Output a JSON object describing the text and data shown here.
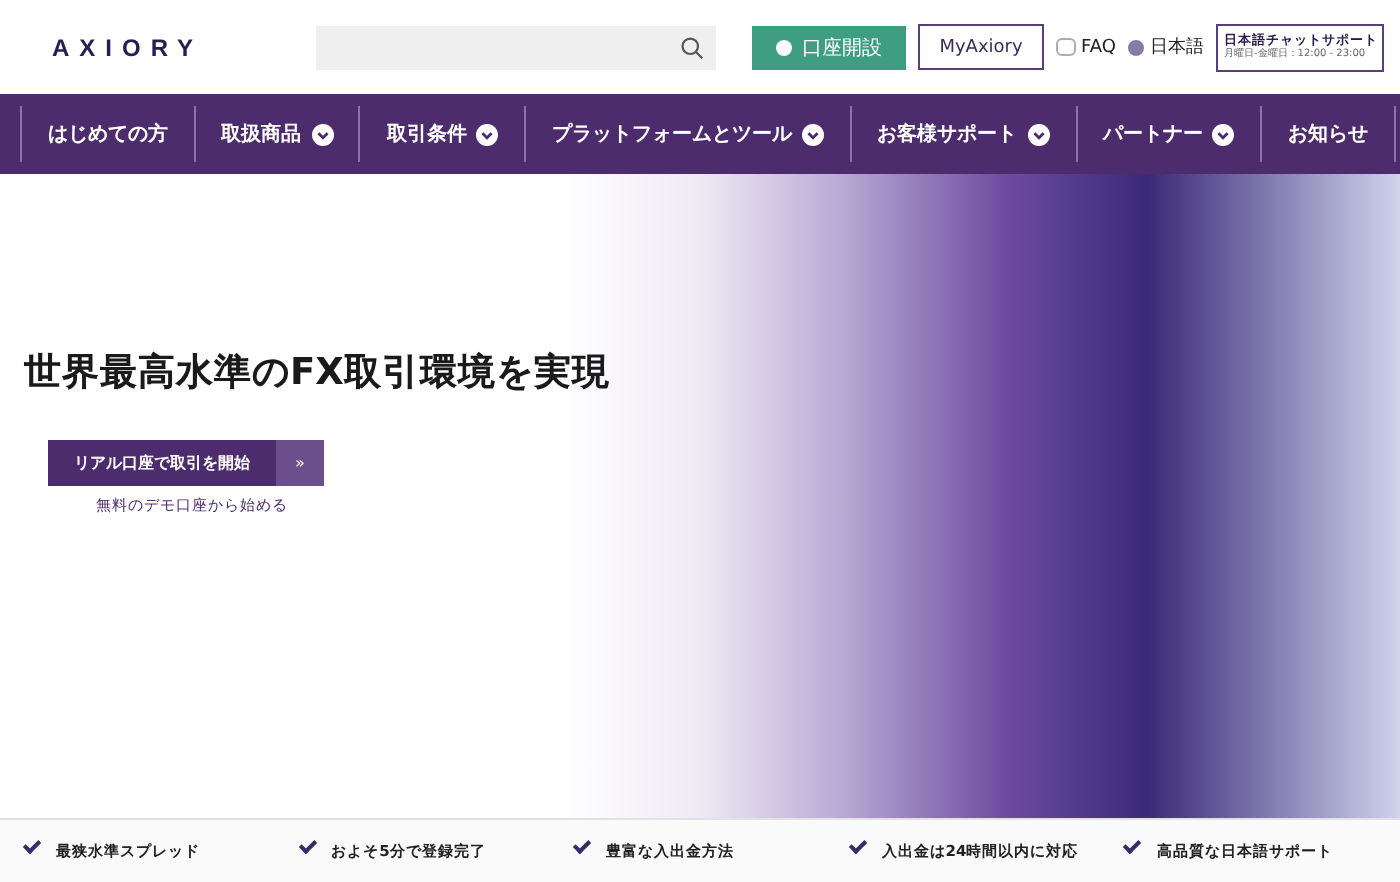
{
  "header": {
    "logo": "AXIORY",
    "open_account_button": "口座開設",
    "myaxiory_button": "MyAxiory",
    "faq_link": "FAQ",
    "language_link": "日本語",
    "chat_support": {
      "title": "日本語チャットサポート",
      "hours": "月曜日-金曜日：12:00 - 23:00"
    }
  },
  "nav": [
    {
      "label": "はじめての方",
      "dropdown": false
    },
    {
      "label": "取扱商品",
      "dropdown": true
    },
    {
      "label": "取引条件",
      "dropdown": true
    },
    {
      "label": "プラットフォームとツール",
      "dropdown": true
    },
    {
      "label": "お客様サポート",
      "dropdown": true
    },
    {
      "label": "パートナー",
      "dropdown": true
    },
    {
      "label": "お知らせ",
      "dropdown": false
    }
  ],
  "hero": {
    "headline": "世界最高水準のFX取引環境を実現",
    "cta_button": "リアル口座で取引を開始",
    "cta_arrow": "»",
    "demo_link": "無料のデモ口座から始める"
  },
  "features": [
    "最狭水準スプレッド",
    "およそ5分で登録完了",
    "豊富な入出金方法",
    "入出金は24時間以内に対応",
    "高品質な日本語サポート"
  ]
}
